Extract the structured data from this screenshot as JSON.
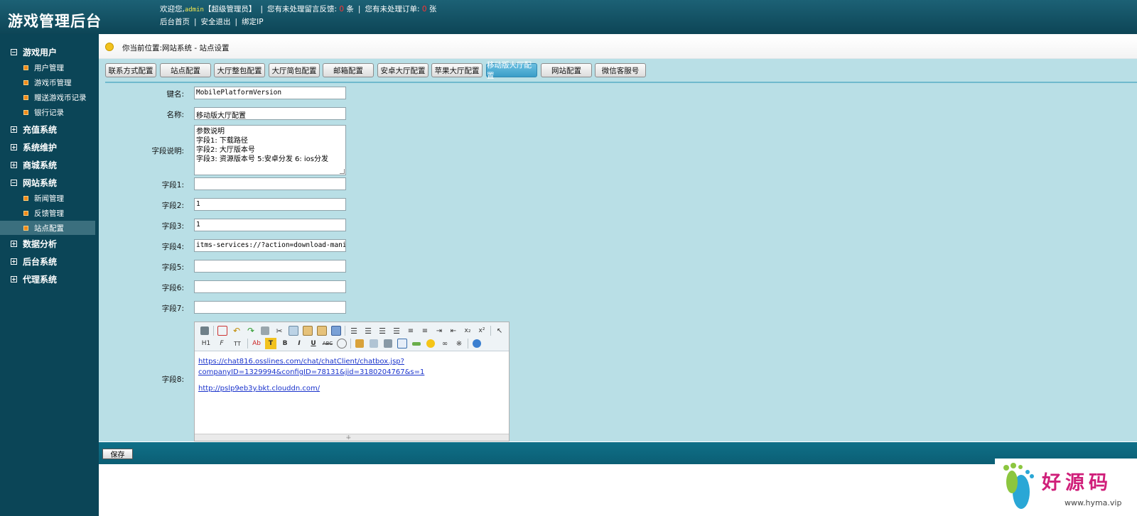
{
  "header": {
    "title": "游戏管理后台",
    "welcome_prefix": "欢迎您,",
    "username": "admin",
    "role": "【超级管理员】",
    "feedback_prefix": "您有未处理留言反馈:",
    "feedback_count": "0",
    "feedback_unit": "条",
    "order_prefix": "您有未处理订单:",
    "order_count": "0",
    "order_unit": "张",
    "links": [
      "后台首页",
      "安全退出",
      "绑定IP"
    ]
  },
  "sidebar": {
    "groups": [
      {
        "label": "游戏用户",
        "expanded": true
      },
      {
        "label": "充值系统",
        "expanded": false
      },
      {
        "label": "系统维护",
        "expanded": false
      },
      {
        "label": "商城系统",
        "expanded": false
      },
      {
        "label": "网站系统",
        "expanded": true
      },
      {
        "label": "数据分析",
        "expanded": false
      },
      {
        "label": "后台系统",
        "expanded": false
      },
      {
        "label": "代理系统",
        "expanded": false
      }
    ],
    "items": [
      {
        "label": "用户管理"
      },
      {
        "label": "游戏币管理"
      },
      {
        "label": "赠送游戏币记录"
      },
      {
        "label": "银行记录"
      },
      {
        "label": "新闻管理"
      },
      {
        "label": "反馈管理"
      },
      {
        "label": "站点配置",
        "active": true
      }
    ]
  },
  "breadcrumb": "你当前位置:网站系统 - 站点设置",
  "tabs": [
    "联系方式配置",
    "站点配置",
    "大厅整包配置",
    "大厅简包配置",
    "邮箱配置",
    "安卓大厅配置",
    "苹果大厅配置",
    "移动版大厅配置",
    "网站配置",
    "微信客服号"
  ],
  "active_tab": "移动版大厅配置",
  "form": {
    "key": {
      "label": "键名:",
      "value": "MobilePlatformVersion"
    },
    "name": {
      "label": "名称:",
      "value": "移动版大厅配置"
    },
    "desc": {
      "label": "字段说明:",
      "value": "参数说明\n字段1: 下载路径\n字段2: 大厅版本号\n字段3: 资源版本号 5:安卓分发 6: ios分发"
    },
    "f1": {
      "label": "字段1:",
      "value": ""
    },
    "f2": {
      "label": "字段2:",
      "value": "1"
    },
    "f3": {
      "label": "字段3:",
      "value": "1"
    },
    "f4": {
      "label": "字段4:",
      "value": "itms-services://?action=download-manifest&"
    },
    "f5": {
      "label": "字段5:",
      "value": ""
    },
    "f6": {
      "label": "字段6:",
      "value": ""
    },
    "f7": {
      "label": "字段7:",
      "value": ""
    },
    "f8": {
      "label": "字段8:",
      "link1_line1": "https://chat816.osslines.com/chat/chatClient/chatbox.jsp?",
      "link1_line2": "companyID=1329994&configID=78131&jid=3180204767&s=1",
      "link2": "http://pslp9eb3y.bkt.clouddn.com/"
    }
  },
  "editor_toolbar": {
    "row1": [
      "source-icon",
      "preview-icon",
      "undo-icon",
      "redo-icon",
      "print-icon",
      "cut-icon",
      "copy-icon",
      "paste-icon",
      "paste-text-icon",
      "paste-word-icon",
      "align-left-icon",
      "align-center-icon",
      "align-right-icon",
      "justify-icon",
      "ordered-list-icon",
      "unordered-list-icon",
      "indent-icon",
      "outdent-icon",
      "subscript-icon",
      "superscript-icon",
      "select-all-icon"
    ],
    "row2": [
      "heading-icon",
      "font-family-icon",
      "font-size-icon",
      "font-color-icon",
      "highlight-icon",
      "bold-icon",
      "italic-icon",
      "underline-icon",
      "strikethrough-icon",
      "remove-format-icon",
      "image-icon",
      "flash-icon",
      "media-icon",
      "table-icon",
      "hr-icon",
      "emoticon-icon",
      "link-icon",
      "unlink-icon",
      "help-icon"
    ],
    "labels": {
      "heading": "H1",
      "font_family": "F",
      "font_size": "TT",
      "font_color": "Ab",
      "bold": "B",
      "italic": "I",
      "underline": "U",
      "strike": "ABC",
      "sub": "x₂",
      "sup": "x²"
    }
  },
  "save_label": "保存",
  "watermark": {
    "text": "好源码",
    "url": "www.hyma.vip"
  },
  "colors": {
    "header_bg": "#0d4556",
    "sidebar_bg": "#0b4557",
    "main_bg": "#b9dfe6",
    "active_tab": "#3a9dc8",
    "counts": "#ff3333"
  }
}
